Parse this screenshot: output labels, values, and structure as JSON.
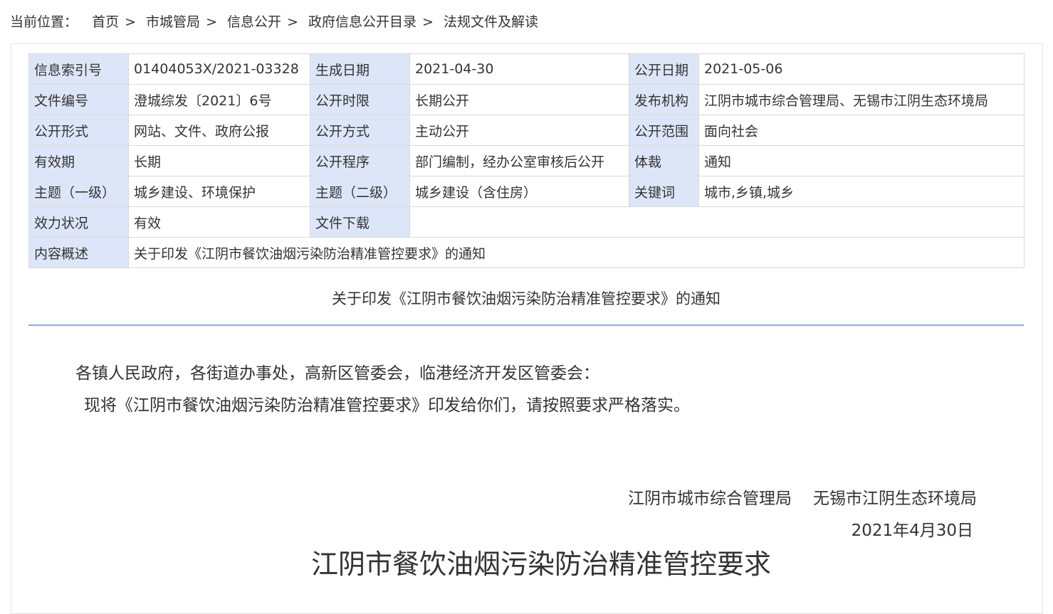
{
  "breadcrumb": {
    "label": "当前位置：",
    "items": [
      "首页",
      "市城管局",
      "信息公开",
      "政府信息公开目录",
      "法规文件及解读"
    ],
    "separator": ">"
  },
  "meta": {
    "index_no_key": "信息索引号",
    "index_no": "01404053X/2021-03328",
    "created_key": "生成日期",
    "created": "2021-04-30",
    "published_key": "公开日期",
    "published": "2021-05-06",
    "doc_no_key": "文件编号",
    "doc_no": "澄城综发〔2021〕6号",
    "time_limit_key": "公开时限",
    "time_limit": "长期公开",
    "issuer_key": "发布机构",
    "issuer": "江阴市城市综合管理局、无锡市江阴生态环境局",
    "form_key": "公开形式",
    "form": "网站、文件、政府公报",
    "method_key": "公开方式",
    "method": "主动公开",
    "scope_key": "公开范围",
    "scope": "面向社会",
    "validity_key": "有效期",
    "validity": "长期",
    "procedure_key": "公开程序",
    "procedure": "部门编制，经办公室审核后公开",
    "genre_key": "体裁",
    "genre": "通知",
    "topic1_key": "主题（一级）",
    "topic1": "城乡建设、环境保护",
    "topic2_key": "主题（二级）",
    "topic2": "城乡建设（含住房）",
    "keywords_key": "关键词",
    "keywords": "城市,乡镇,城乡",
    "status_key": "效力状况",
    "status": "有效",
    "download_key": "文件下载",
    "download": "",
    "summary_key": "内容概述",
    "summary": "关于印发《江阴市餐饮油烟污染防治精准管控要求》的通知"
  },
  "document": {
    "title": "关于印发《江阴市餐饮油烟污染防治精准管控要求》的通知",
    "salutation": "各镇人民政府，各街道办事处，高新区管委会，临港经济开发区管委会：",
    "paragraph": "现将《江阴市餐饮油烟污染防治精准管控要求》印发给你们，请按照要求严格落实。",
    "signer1": "江阴市城市综合管理局",
    "signer2": "无锡市江阴生态环境局",
    "date": "2021年4月30日",
    "attachment_title": "江阴市餐饮油烟污染防治精准管控要求"
  },
  "colors": {
    "label_cell_bg": "#dde6f8",
    "divider": "#8fa9d8",
    "border": "#d9d9d9",
    "text": "#333333"
  }
}
